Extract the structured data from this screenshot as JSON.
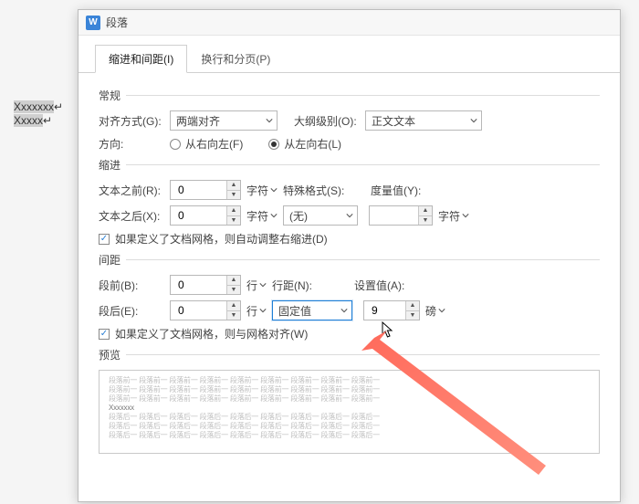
{
  "bg": {
    "line1": "Xxxxxxx",
    "line2": "Xxxxx"
  },
  "dialog": {
    "app_letter": "W",
    "title": "段落",
    "tabs": {
      "indent": "缩进和间距(I)",
      "paginate": "换行和分页(P)"
    },
    "general": {
      "header": "常规",
      "align_label": "对齐方式(G):",
      "align_value": "两端对齐",
      "outline_label": "大纲级别(O):",
      "outline_value": "正文文本",
      "direction_label": "方向:",
      "rtl_label": "从右向左(F)",
      "ltr_label": "从左向右(L)"
    },
    "indent": {
      "header": "缩进",
      "before_label": "文本之前(R):",
      "before_value": "0",
      "after_label": "文本之后(X):",
      "after_value": "0",
      "unit_char": "字符",
      "special_label": "特殊格式(S):",
      "special_value": "(无)",
      "measure_label": "度量值(Y):",
      "measure_value": "",
      "measure_unit": "字符",
      "grid_check": "如果定义了文档网格，则自动调整右缩进(D)"
    },
    "spacing": {
      "header": "间距",
      "before_label": "段前(B):",
      "before_value": "0",
      "after_label": "段后(E):",
      "after_value": "0",
      "unit_line": "行",
      "linespacing_label": "行距(N):",
      "linespacing_value": "固定值",
      "setvalue_label": "设置值(A):",
      "setvalue_value": "9",
      "setvalue_unit": "磅",
      "grid_check": "如果定义了文档网格，则与网格对齐(W)"
    },
    "preview": {
      "header": "预览",
      "light_rep": "段落前一",
      "sample": "Xxxxxxx",
      "after_rep": "段落后一"
    }
  }
}
